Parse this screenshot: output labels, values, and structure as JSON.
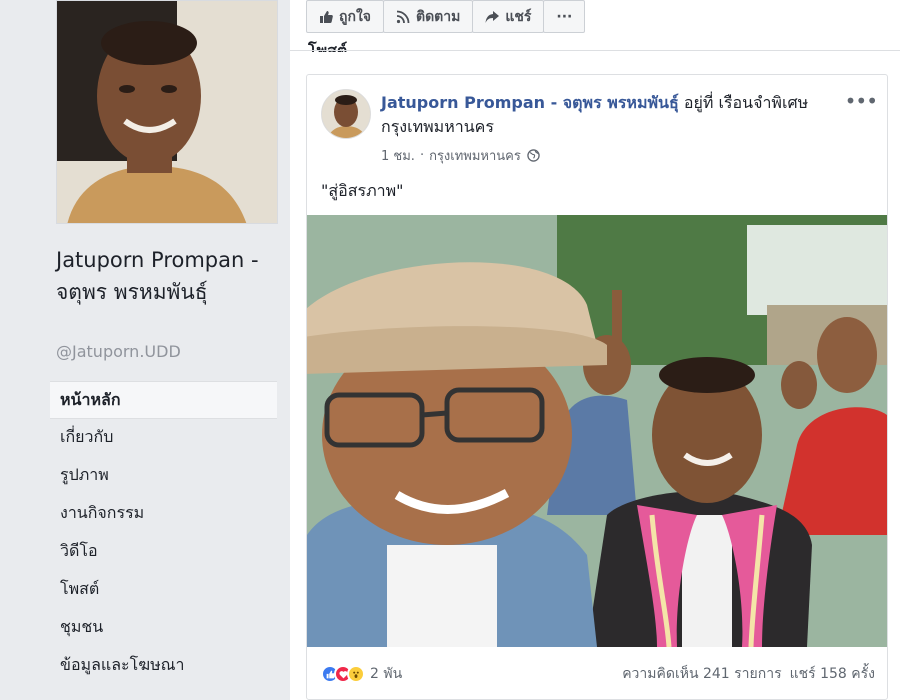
{
  "sidebar": {
    "name": "Jatuporn Prompan - จตุพร พรหมพันธุ์",
    "handle": "@Jatuporn.UDD",
    "items": [
      {
        "label": "หน้าหลัก",
        "active": true
      },
      {
        "label": "เกี่ยวกับ"
      },
      {
        "label": "รูปภาพ"
      },
      {
        "label": "งานกิจกรรม"
      },
      {
        "label": "วิดีโอ"
      },
      {
        "label": "โพสต์"
      },
      {
        "label": "ชุมชน"
      },
      {
        "label": "ข้อมูลและโฆษณา"
      }
    ]
  },
  "actions": {
    "like": "ถูกใจ",
    "follow": "ติดตาม",
    "share": "แชร์",
    "more": "···"
  },
  "section_title": "โพสต์",
  "post": {
    "author": "Jatuporn Prompan - จตุพร พรหมพันธุ์",
    "location_text": " อยู่ที่ เรือนจำพิเศษกรุงเทพมหานคร",
    "time": "1 ชม.",
    "separator": "·",
    "place": "กรุงเทพมหานคร",
    "text": "\"สู่อิสรภาพ\"",
    "more": "•••",
    "reactions_count": "2 พัน",
    "comments": "ความคิดเห็น 241 รายการ",
    "shares": "แชร์ 158 ครั้ง",
    "icons": [
      "like-reaction",
      "love-reaction",
      "wow-reaction",
      "globe-icon"
    ]
  },
  "colors": {
    "link": "#385898",
    "background": "#e9ebee",
    "like": "#3b7af0",
    "love": "#f0284a",
    "wow": "#fbcd3b"
  }
}
